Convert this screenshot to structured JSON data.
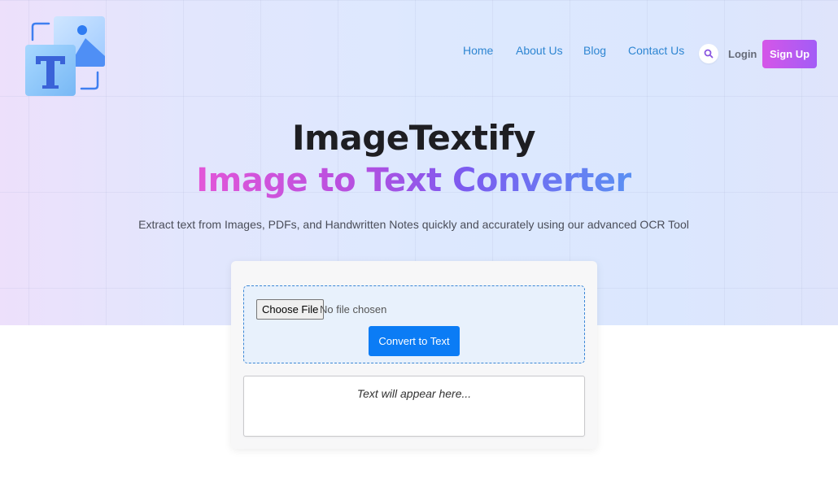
{
  "brand": {
    "logo_letter": "T",
    "logo_icon": "image-text-logo-icon"
  },
  "nav": {
    "links": [
      {
        "label": "Home"
      },
      {
        "label": "About Us"
      },
      {
        "label": "Blog"
      },
      {
        "label": "Contact Us"
      }
    ],
    "search_icon": "search-icon",
    "login_label": "Login",
    "signup_label": "Sign Up"
  },
  "hero": {
    "title": "ImageTextify",
    "subtitle": "Image to Text Converter",
    "tagline": "Extract text from Images, PDFs, and Handwritten Notes quickly and accurately using our advanced OCR Tool"
  },
  "converter": {
    "choose_file_label": "Choose File",
    "file_status": "No file chosen",
    "convert_label": "Convert to Text",
    "output_placeholder": "Text will appear here..."
  },
  "colors": {
    "accent_blue": "#0b7cf5",
    "nav_link": "#2e86d2",
    "signup_gradient_start": "#d556e8",
    "signup_gradient_end": "#a35cf6"
  }
}
